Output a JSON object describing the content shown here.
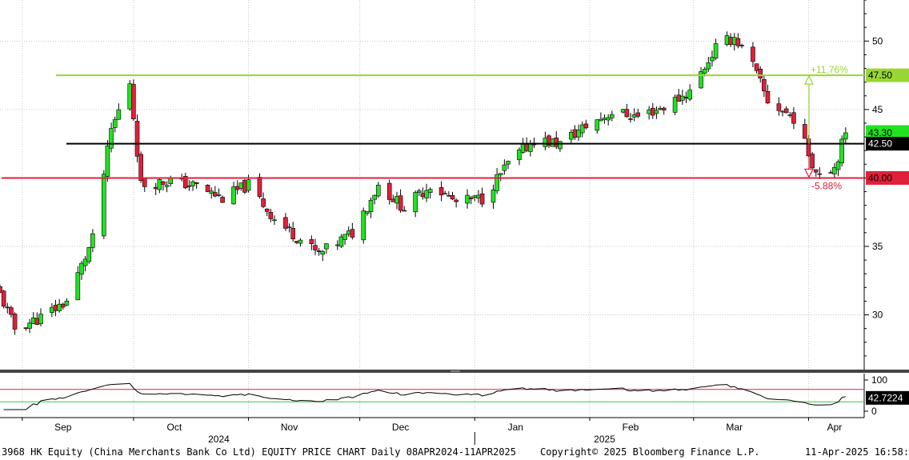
{
  "chart_data": {
    "type": "candlestick",
    "interval": "Daily",
    "y_axis_ticks": [
      30,
      35,
      45,
      50
    ],
    "ylim": [
      26,
      53
    ],
    "x_axis": {
      "month_labels": [
        "Sep",
        "Oct",
        "Nov",
        "Dec",
        "Jan",
        "Feb",
        "Mar",
        "Apr"
      ],
      "year_labels": [
        "2024",
        "2025"
      ]
    },
    "price_series_approx": [
      {
        "date": "2024-08-26",
        "close": 31.5
      },
      {
        "date": "2024-08-30",
        "close": 29.0
      },
      {
        "date": "2024-09-06",
        "close": 29.8
      },
      {
        "date": "2024-09-13",
        "close": 31.0
      },
      {
        "date": "2024-09-20",
        "close": 35.5
      },
      {
        "date": "2024-09-25",
        "close": 43.5
      },
      {
        "date": "2024-09-30",
        "close": 47.0
      },
      {
        "date": "2024-10-03",
        "close": 39.5
      },
      {
        "date": "2024-10-11",
        "close": 39.8
      },
      {
        "date": "2024-10-18",
        "close": 39.4
      },
      {
        "date": "2024-10-25",
        "close": 38.5
      },
      {
        "date": "2024-11-01",
        "close": 39.5
      },
      {
        "date": "2024-11-08",
        "close": 37.0
      },
      {
        "date": "2024-11-15",
        "close": 35.5
      },
      {
        "date": "2024-11-20",
        "close": 34.4
      },
      {
        "date": "2024-11-29",
        "close": 36.0
      },
      {
        "date": "2024-12-06",
        "close": 39.5
      },
      {
        "date": "2024-12-13",
        "close": 37.8
      },
      {
        "date": "2024-12-20",
        "close": 39.5
      },
      {
        "date": "2024-12-27",
        "close": 38.2
      },
      {
        "date": "2025-01-03",
        "close": 38.5
      },
      {
        "date": "2025-01-10",
        "close": 41.0
      },
      {
        "date": "2025-01-17",
        "close": 42.8
      },
      {
        "date": "2025-01-24",
        "close": 42.5
      },
      {
        "date": "2025-01-31",
        "close": 43.8
      },
      {
        "date": "2025-02-07",
        "close": 44.8
      },
      {
        "date": "2025-02-14",
        "close": 44.5
      },
      {
        "date": "2025-02-21",
        "close": 45.2
      },
      {
        "date": "2025-02-28",
        "close": 46.3
      },
      {
        "date": "2025-03-07",
        "close": 49.5
      },
      {
        "date": "2025-03-12",
        "close": 50.3
      },
      {
        "date": "2025-03-17",
        "close": 48.2
      },
      {
        "date": "2025-03-21",
        "close": 45.6
      },
      {
        "date": "2025-03-28",
        "close": 44.4
      },
      {
        "date": "2025-04-03",
        "close": 40.5
      },
      {
        "date": "2025-04-08",
        "close": 40.8
      },
      {
        "date": "2025-04-11",
        "close": 43.3
      }
    ],
    "last_price_label": "43.30",
    "horizontal_lines": [
      {
        "value": 47.5,
        "label": "47.50",
        "color": "#99d633"
      },
      {
        "value": 42.5,
        "label": "42.50",
        "color": "#000000"
      },
      {
        "value": 40.0,
        "label": "40.00",
        "color": "#e0203a"
      }
    ],
    "annotations": [
      {
        "text": "+11.76%",
        "color": "#99d633"
      },
      {
        "text": "-5.88%",
        "color": "#e0203a"
      }
    ],
    "indicator_panel": {
      "y_ticks": [
        100,
        0
      ],
      "upper_band": 70,
      "lower_band": 30,
      "last_value_label": "42.7224",
      "band_colors": {
        "upper": "#e0203a",
        "lower": "#33cc33"
      }
    },
    "colors": {
      "up_candle": "#22e222",
      "down_candle": "#e0203a",
      "grid": "#c8c8c8",
      "indicator_line": "#000000"
    }
  },
  "footer": {
    "title": "3968 HK Equity (China Merchants Bank Co Ltd) EQUITY PRICE CHART  Daily 08APR2024-11APR2025",
    "copyright": "Copyright© 2025 Bloomberg Finance L.P.",
    "timestamp": "11-Apr-2025 16:58:30"
  }
}
